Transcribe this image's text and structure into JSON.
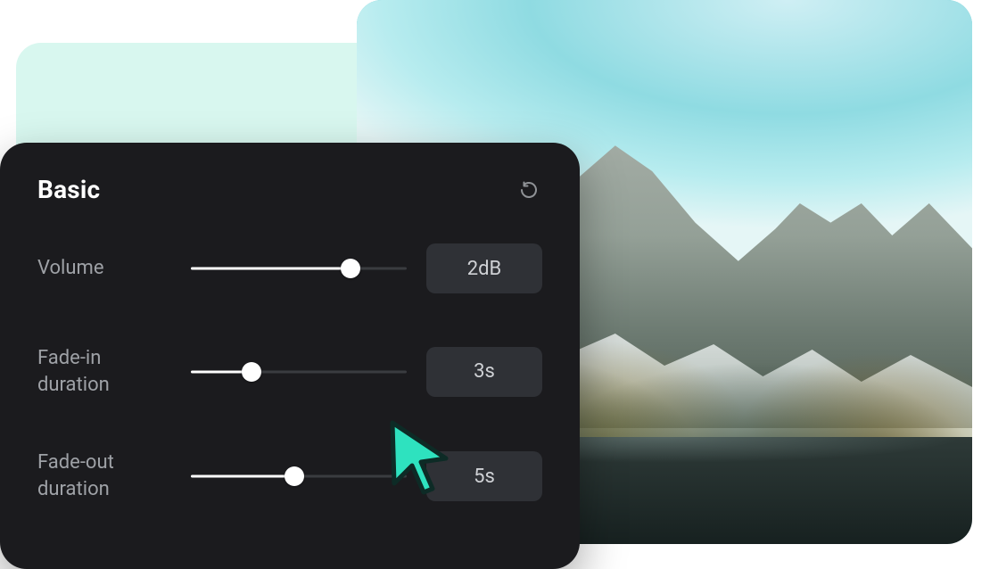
{
  "panel": {
    "title": "Basic",
    "rows": [
      {
        "label": "Volume",
        "value": "2dB",
        "fill_pct": 74
      },
      {
        "label": "Fade-in duration",
        "value": "3s",
        "fill_pct": 28
      },
      {
        "label": "Fade-out duration",
        "value": "5s",
        "fill_pct": 48
      }
    ]
  },
  "colors": {
    "accent": "#2ee2bf"
  }
}
